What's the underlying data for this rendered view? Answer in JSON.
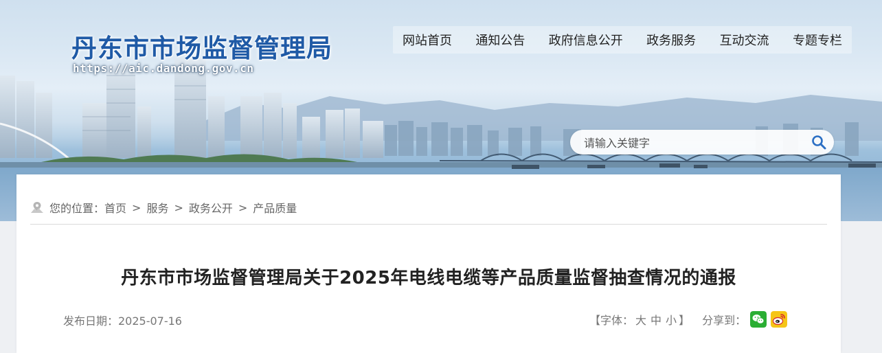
{
  "header": {
    "site_title": "丹东市市场监督管理局",
    "site_url": "https://aic.dandong.gov.cn"
  },
  "nav": {
    "items": [
      "网站首页",
      "通知公告",
      "政府信息公开",
      "政务服务",
      "互动交流",
      "专题专栏"
    ]
  },
  "search": {
    "placeholder": "请输入关键字",
    "icon": "search-icon"
  },
  "breadcrumb": {
    "icon": "location-icon",
    "prefix": "您的位置：",
    "items": [
      "首页",
      "服务",
      "政务公开",
      "产品质量"
    ],
    "separator": ">"
  },
  "article": {
    "title": "丹东市市场监督管理局关于2025年电线电缆等产品质量监督抽查情况的通报",
    "publish_date": "发布日期：2025-07-16"
  },
  "tools": {
    "font_open": "【字体：",
    "font_large": "大",
    "font_medium": "中",
    "font_small": "小",
    "font_close": "】",
    "share_label": "分享到：",
    "share_icons": [
      "wechat-icon",
      "weibo-icon"
    ]
  },
  "colors": {
    "title_blue": "#1f5aa6",
    "wechat_green": "#2aae33",
    "weibo_yellow": "#f5c518",
    "search_icon_blue": "#2b6fc4"
  }
}
